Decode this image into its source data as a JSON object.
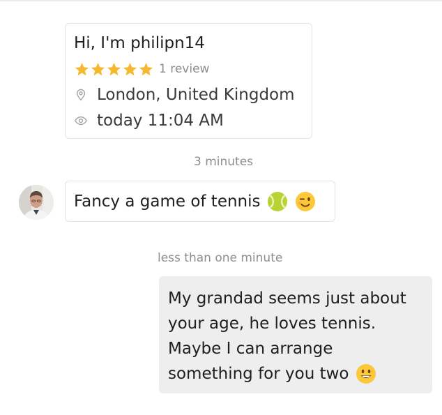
{
  "profile": {
    "title": "Hi, I'm philipn14",
    "rating": 5,
    "review_count": "1 review",
    "location": "London, United Kingdom",
    "last_seen": "today 11:04 AM"
  },
  "conversation": {
    "timestamp_1": "3 minutes",
    "incoming_message": "Fancy a game of tennis",
    "incoming_emojis": [
      "tennis-ball-icon",
      "winking-face-icon"
    ],
    "timestamp_2": "less than one minute",
    "outgoing_lines": [
      "My grandad seems just about",
      "your age, he loves tennis.",
      "Maybe I can arrange",
      "something for you two"
    ],
    "outgoing_emoji": "smiling-face-icon"
  },
  "colors": {
    "star": "#f5b82e",
    "bubble_outgoing": "#eeeeee",
    "border": "#e3e3e3",
    "muted_text": "#8e8e8e"
  }
}
